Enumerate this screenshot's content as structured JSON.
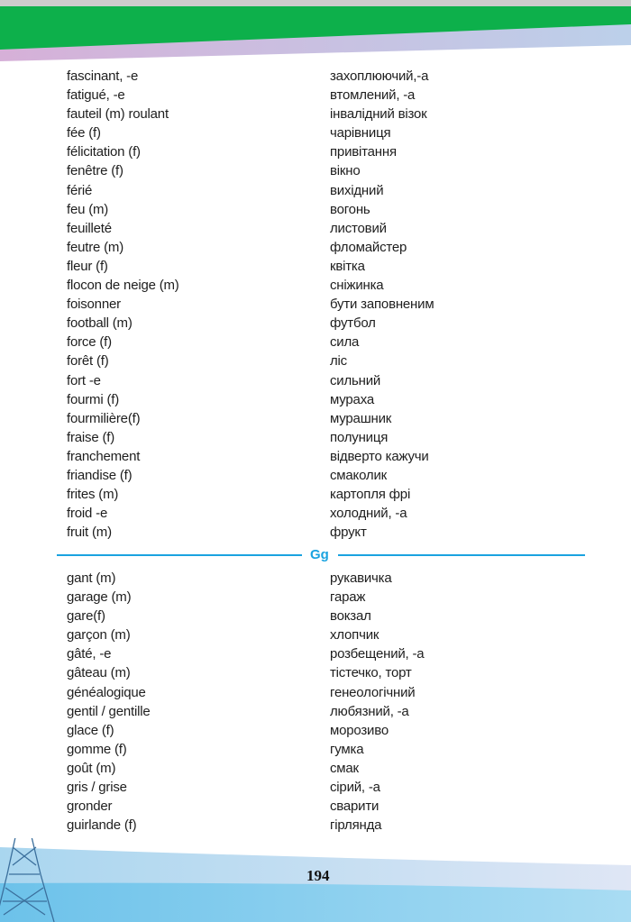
{
  "colors": {
    "banner_green": "#0db04b",
    "banner_lavender": "#c6b9dc",
    "section_accent": "#1aa3e0",
    "bottom_blue": "#8fd0f0"
  },
  "section_f": {
    "entries": [
      {
        "fr": "fascinant, -e",
        "uk": "захоплюючий,-а"
      },
      {
        "fr": "fatigué, -e",
        "uk": "втомлений, -а"
      },
      {
        "fr": "fauteil (m) roulant",
        "uk": "інвалідний візок"
      },
      {
        "fr": "fée (f)",
        "uk": "чарівниця"
      },
      {
        "fr": "félicitation (f)",
        "uk": "привітання"
      },
      {
        "fr": "fenêtre (f)",
        "uk": "вікно"
      },
      {
        "fr": "férié",
        "uk": "вихідний"
      },
      {
        "fr": "feu (m)",
        "uk": "вогонь"
      },
      {
        "fr": "feuilleté",
        "uk": "листовий"
      },
      {
        "fr": "feutre (m)",
        "uk": "фломайстер"
      },
      {
        "fr": "fleur (f)",
        "uk": "квітка"
      },
      {
        "fr": "flocon de neige (m)",
        "uk": "сніжинка"
      },
      {
        "fr": "foisonner",
        "uk": "бути заповненим"
      },
      {
        "fr": "football (m)",
        "uk": "футбол"
      },
      {
        "fr": "force (f)",
        "uk": "сила"
      },
      {
        "fr": "forêt (f)",
        "uk": "ліс"
      },
      {
        "fr": "fort -e",
        "uk": "сильний"
      },
      {
        "fr": "fourmi (f)",
        "uk": "мураха"
      },
      {
        "fr": "fourmilière(f)",
        "uk": "мурашник"
      },
      {
        "fr": "fraise (f)",
        "uk": "полуниця"
      },
      {
        "fr": "franchement",
        "uk": "відверто кажучи"
      },
      {
        "fr": "friandise (f)",
        "uk": "смаколик"
      },
      {
        "fr": "frites (m)",
        "uk": "картопля фрі"
      },
      {
        "fr": "froid -e",
        "uk": "холодний, -а"
      },
      {
        "fr": "fruit (m)",
        "uk": "фрукт"
      }
    ]
  },
  "section_g": {
    "letter": "Gg",
    "entries": [
      {
        "fr": "gant (m)",
        "uk": "рукавичка"
      },
      {
        "fr": "garage (m)",
        "uk": "гараж"
      },
      {
        "fr": "gare(f)",
        "uk": "вокзал"
      },
      {
        "fr": "garçon (m)",
        "uk": "хлопчик"
      },
      {
        "fr": "gâté, -e",
        "uk": "розбещений, -а"
      },
      {
        "fr": "gâteau (m)",
        "uk": "тістечко, торт"
      },
      {
        "fr": "généalogique",
        "uk": "генеологічний"
      },
      {
        "fr": "gentil / gentille",
        "uk": "любязний, -а"
      },
      {
        "fr": "glace (f)",
        "uk": "морозиво"
      },
      {
        "fr": "gomme (f)",
        "uk": "гумка"
      },
      {
        "fr": "goût (m)",
        "uk": "смак"
      },
      {
        "fr": "gris / grise",
        "uk": "сірий, -а"
      },
      {
        "fr": "gronder",
        "uk": "сварити"
      },
      {
        "fr": "guirlande (f)",
        "uk": "гірлянда"
      }
    ]
  },
  "footer": {
    "page_number": "194",
    "decoration_icon": "eiffel-tower-icon"
  }
}
